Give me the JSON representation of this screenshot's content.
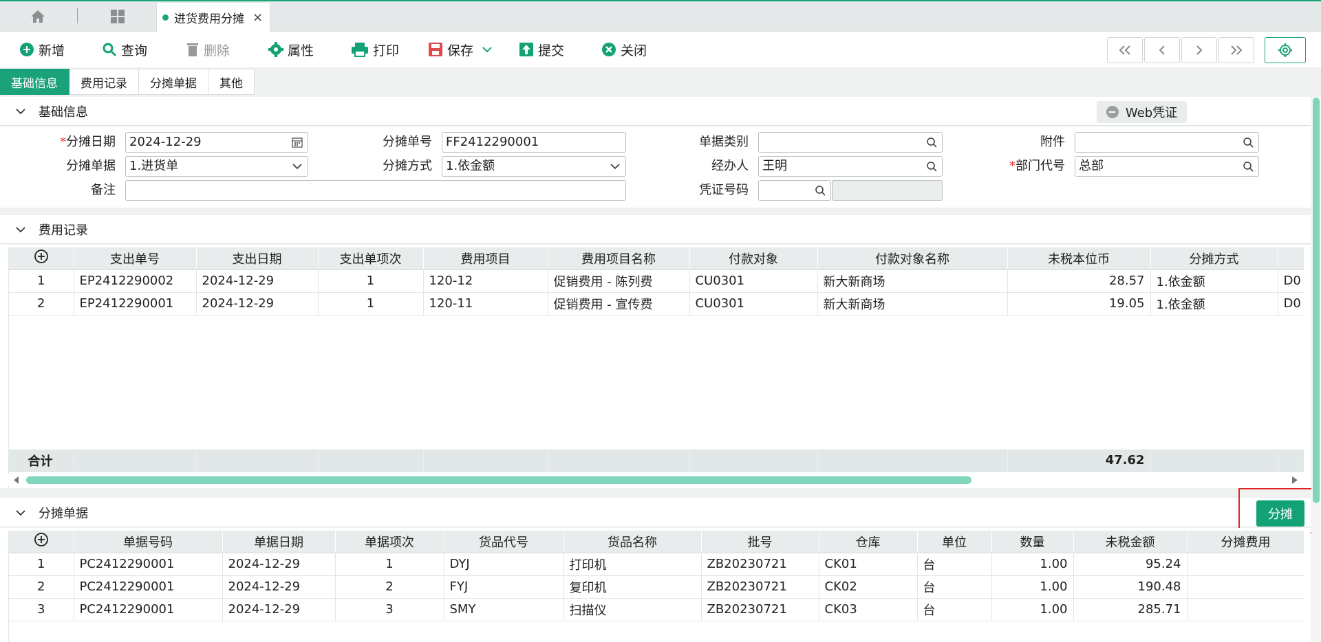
{
  "tabbar": {
    "doc_tab_label": "进货费用分摊"
  },
  "toolbar": {
    "new": "新增",
    "query": "查询",
    "delete": "删除",
    "props": "属性",
    "print": "打印",
    "save": "保存",
    "submit": "提交",
    "close": "关闭"
  },
  "subtabs": [
    "基础信息",
    "费用记录",
    "分摊单据",
    "其他"
  ],
  "basic": {
    "title": "基础信息",
    "web_voucher": "Web凭证",
    "labels": {
      "alloc_date": "分摊日期",
      "alloc_no": "分摊单号",
      "doc_type": "单据类别",
      "attachment": "附件",
      "alloc_doc": "分摊单据",
      "alloc_method": "分摊方式",
      "handler": "经办人",
      "dept_code": "部门代号",
      "remark": "备注",
      "voucher_no": "凭证号码"
    },
    "values": {
      "alloc_date": "2024-12-29",
      "alloc_no": "FF2412290001",
      "doc_type": "",
      "attachment": "",
      "alloc_doc": "1.进货单",
      "alloc_method": "1.依金额",
      "handler": "王明",
      "dept_code": "总部",
      "remark": "",
      "voucher_no": "",
      "voucher_extra": ""
    }
  },
  "expenses": {
    "title": "费用记录",
    "headers": [
      "支出单号",
      "支出日期",
      "支出单项次",
      "费用项目",
      "费用项目名称",
      "付款对象",
      "付款对象名称",
      "未税本位币",
      "分摊方式",
      ""
    ],
    "rows": [
      {
        "idx": "1",
        "no": "EP2412290002",
        "date": "2024-12-29",
        "seq": "1",
        "item": "120-12",
        "item_name": "促销费用 - 陈列费",
        "payee": "CU0301",
        "payee_name": "新大新商场",
        "amount": "28.57",
        "method": "1.依金额",
        "extra": "D0"
      },
      {
        "idx": "2",
        "no": "EP2412290001",
        "date": "2024-12-29",
        "seq": "1",
        "item": "120-11",
        "item_name": "促销费用 - 宣传费",
        "payee": "CU0301",
        "payee_name": "新大新商场",
        "amount": "19.05",
        "method": "1.依金额",
        "extra": "D0"
      }
    ],
    "total_label": "合计",
    "total_amount": "47.62"
  },
  "alloc_docs": {
    "title": "分摊单据",
    "allocate_button": "分摊",
    "headers": [
      "单据号码",
      "单据日期",
      "单据项次",
      "货品代号",
      "货品名称",
      "批号",
      "仓库",
      "单位",
      "数量",
      "未税金额",
      "分摊费用"
    ],
    "rows": [
      {
        "idx": "1",
        "no": "PC2412290001",
        "date": "2024-12-29",
        "seq": "1",
        "code": "DYJ",
        "name": "打印机",
        "batch": "ZB20230721",
        "wh": "CK01",
        "unit": "台",
        "qty": "1.00",
        "amount": "95.24",
        "fee": ""
      },
      {
        "idx": "2",
        "no": "PC2412290001",
        "date": "2024-12-29",
        "seq": "2",
        "code": "FYJ",
        "name": "复印机",
        "batch": "ZB20230721",
        "wh": "CK02",
        "unit": "台",
        "qty": "1.00",
        "amount": "190.48",
        "fee": ""
      },
      {
        "idx": "3",
        "no": "PC2412290001",
        "date": "2024-12-29",
        "seq": "3",
        "code": "SMY",
        "name": "扫描仪",
        "batch": "ZB20230721",
        "wh": "CK03",
        "unit": "台",
        "qty": "1.00",
        "amount": "285.71",
        "fee": ""
      }
    ]
  }
}
